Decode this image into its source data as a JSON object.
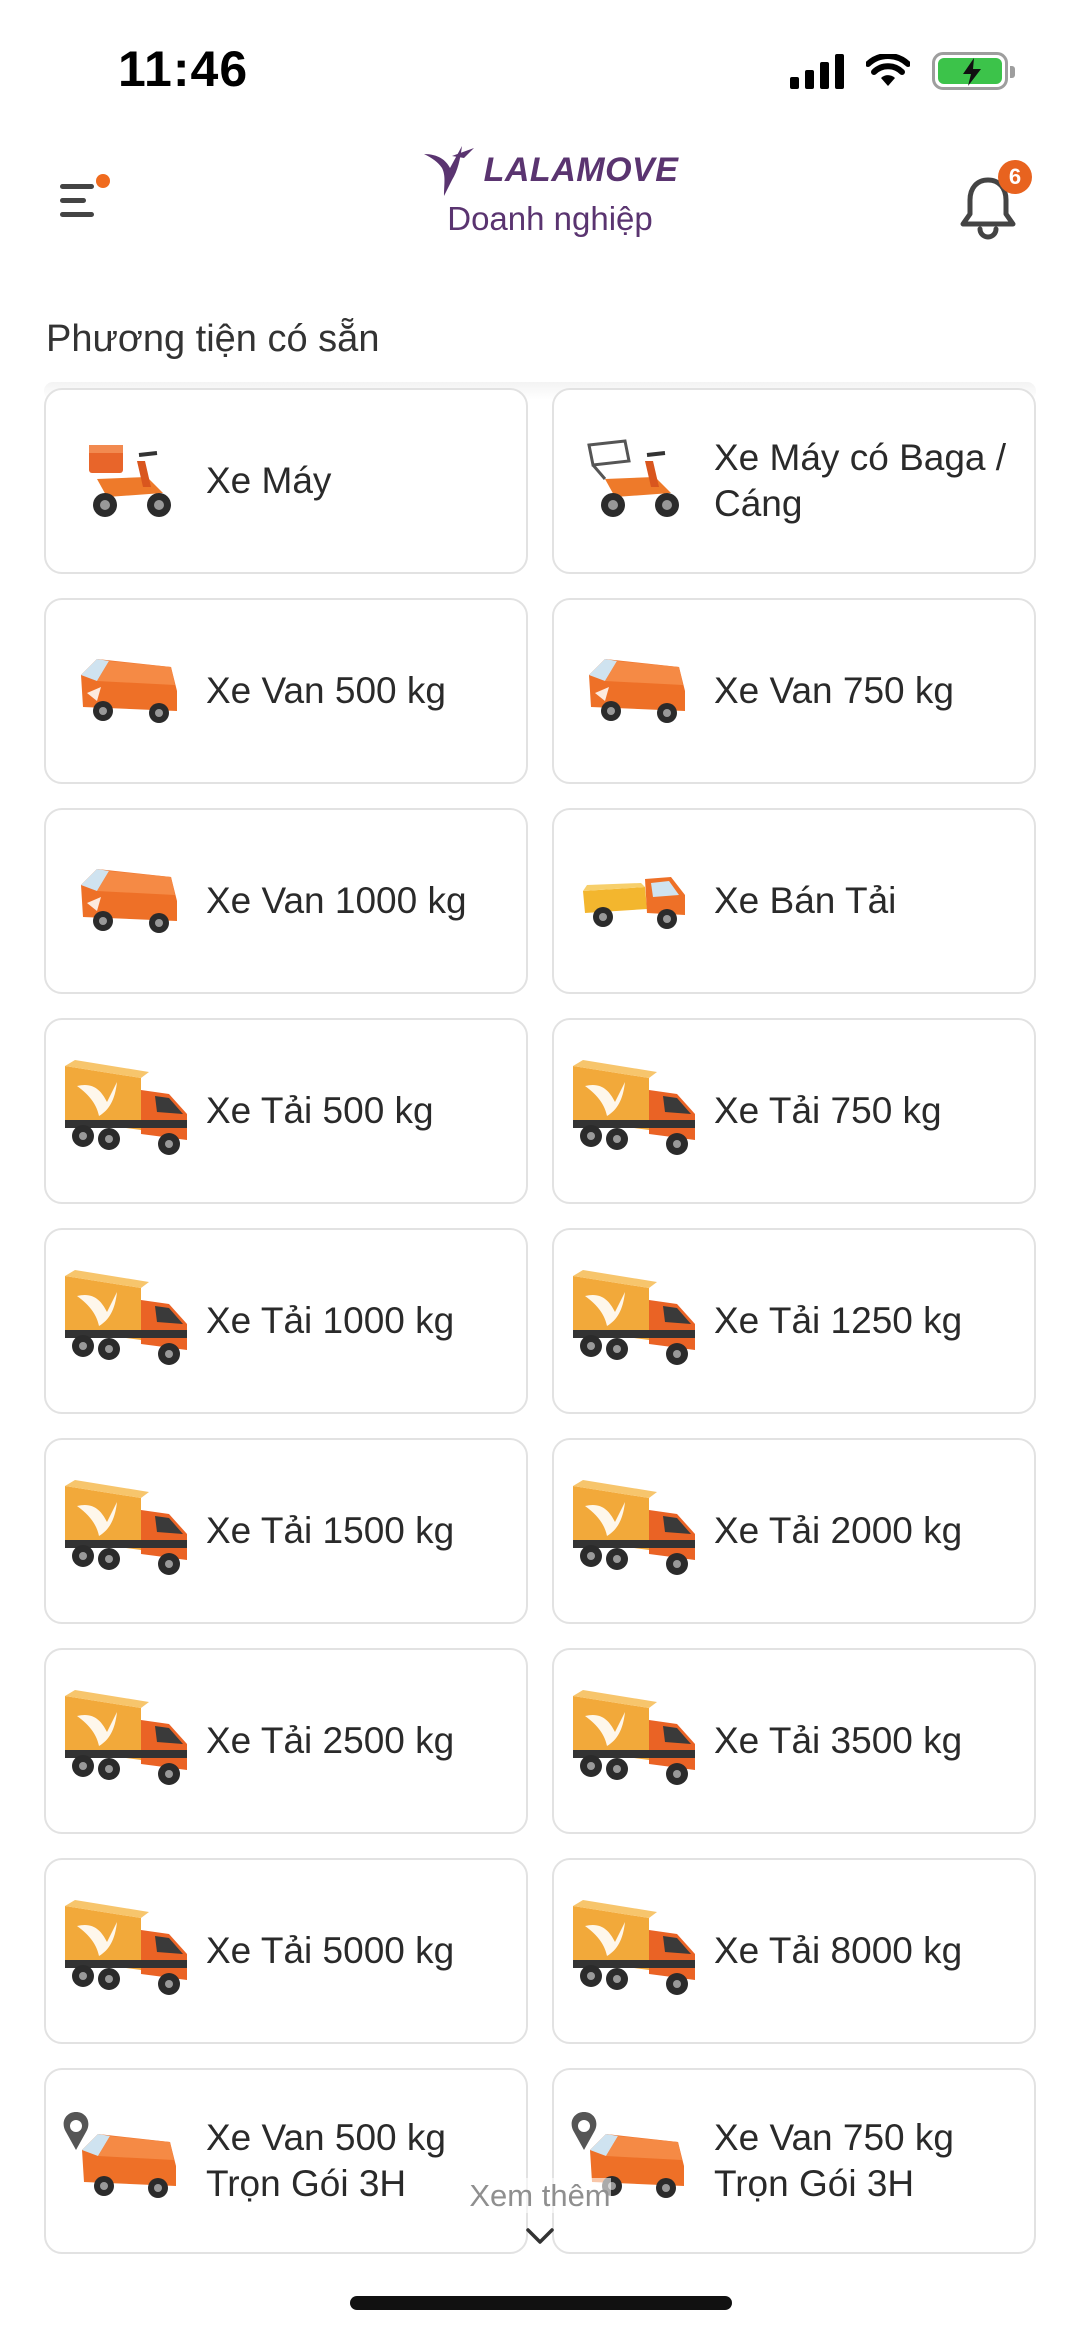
{
  "status_bar": {
    "time": "11:46"
  },
  "header": {
    "brand_name": "LALAMOVE",
    "brand_sub": "Doanh nghiệp",
    "notification_count": "6",
    "brand_color": "#5a3470",
    "accent_color": "#f06b1e"
  },
  "section": {
    "title": "Phương tiện có sẵn"
  },
  "vehicles": [
    {
      "label": "Xe Máy",
      "icon": "motorbike-icon"
    },
    {
      "label": "Xe Máy có Baga / Cáng",
      "icon": "motorbike-rack-icon"
    },
    {
      "label": "Xe Van 500 kg",
      "icon": "van-icon"
    },
    {
      "label": "Xe Van 750 kg",
      "icon": "van-icon"
    },
    {
      "label": "Xe Van 1000 kg",
      "icon": "van-icon"
    },
    {
      "label": "Xe Bán Tải",
      "icon": "pickup-truck-icon"
    },
    {
      "label": "Xe Tải 500 kg",
      "icon": "truck-icon"
    },
    {
      "label": "Xe Tải 750 kg",
      "icon": "truck-icon"
    },
    {
      "label": "Xe Tải 1000 kg",
      "icon": "truck-icon"
    },
    {
      "label": "Xe Tải 1250 kg",
      "icon": "truck-icon"
    },
    {
      "label": "Xe Tải 1500 kg",
      "icon": "truck-icon"
    },
    {
      "label": "Xe Tải 2000 kg",
      "icon": "truck-icon"
    },
    {
      "label": "Xe Tải 2500 kg",
      "icon": "truck-icon"
    },
    {
      "label": "Xe Tải 3500 kg",
      "icon": "truck-icon"
    },
    {
      "label": "Xe Tải 5000 kg",
      "icon": "truck-icon"
    },
    {
      "label": "Xe Tải 8000 kg",
      "icon": "truck-icon"
    },
    {
      "label": "Xe Van 500 kg Trọn Gói 3H",
      "icon": "van-pin-icon"
    },
    {
      "label": "Xe Van 750 kg Trọn Gói 3H",
      "icon": "van-pin-icon"
    }
  ],
  "see_more": {
    "label": "Xem thêm"
  }
}
